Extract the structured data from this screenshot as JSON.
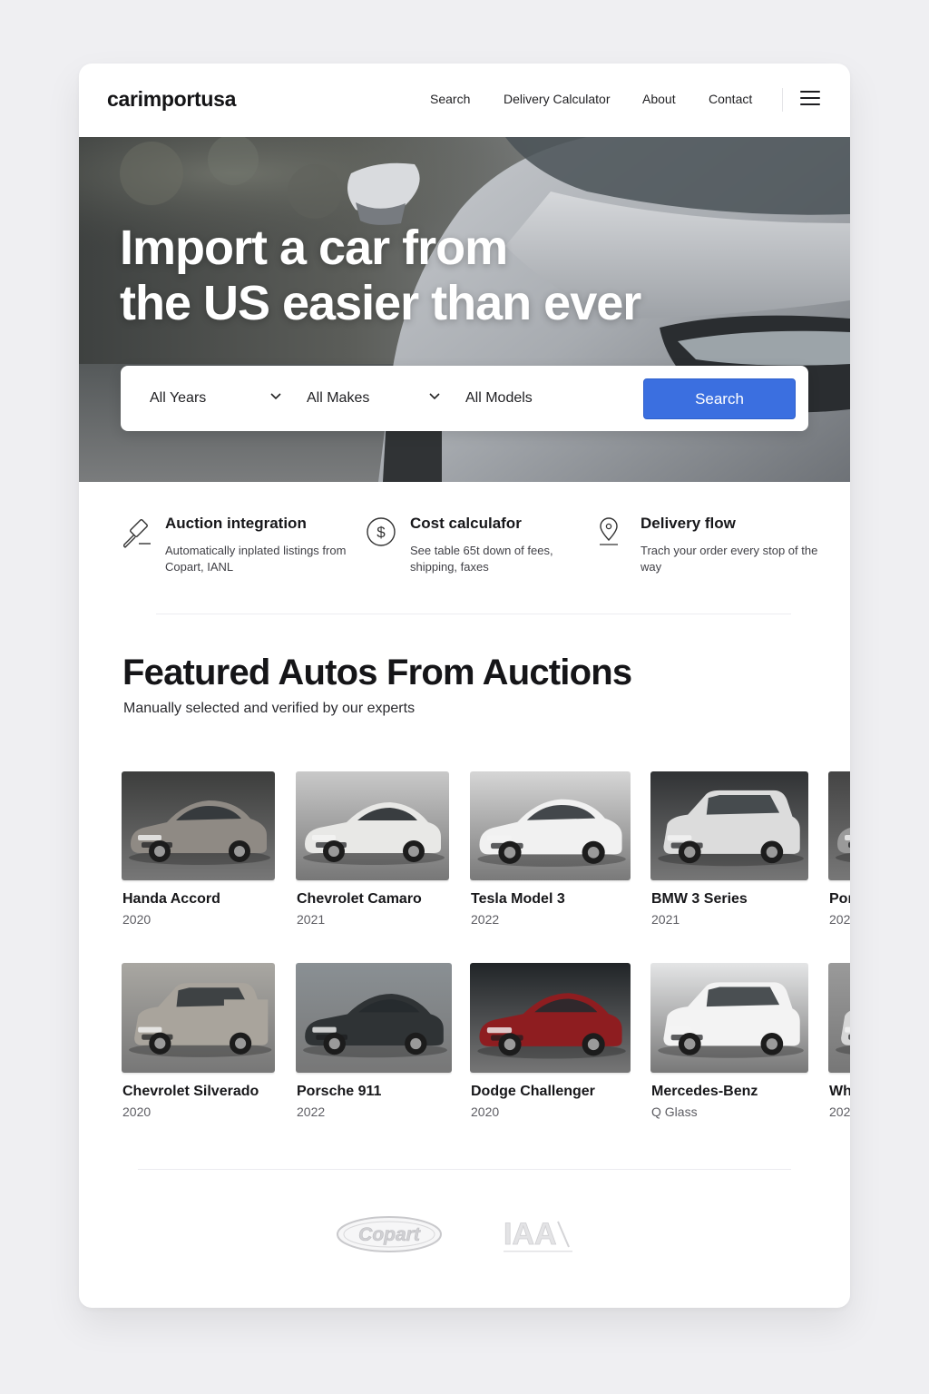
{
  "header": {
    "logo": "carimportusa",
    "nav": {
      "search": "Search",
      "delivery": "Delivery Calculator",
      "about": "About",
      "contact": "Contact"
    }
  },
  "hero": {
    "title_line1": "Import a car from",
    "title_line2": "the US easier than ever",
    "filters": {
      "years": "All Years",
      "makes": "All Makes",
      "models": "All Models"
    },
    "search_button": "Search"
  },
  "features": [
    {
      "title": "Auction integration",
      "desc": "Automatically inplated listings from Copart, IANL",
      "icon": "gavel-icon"
    },
    {
      "title": "Cost calculafor",
      "desc": "See table 65t down of fees, shipping, faxes",
      "icon": "dollar-icon"
    },
    {
      "title": "Delivery flow",
      "desc": "Trach your order every stop of the way",
      "icon": "location-pin-icon"
    }
  ],
  "featured": {
    "title": "Featured Autos From Auctions",
    "subtitle": "Manually selected and verified by our experts"
  },
  "cars": [
    {
      "name": "Handa Accord",
      "year": "2020",
      "color": "#8f8a84",
      "type": "sedan"
    },
    {
      "name": "Chevrolet Camaro",
      "year": "2021",
      "color": "#e8e8e6",
      "type": "coupe"
    },
    {
      "name": "Tesla Model 3",
      "year": "2022",
      "color": "#f1f1f1",
      "type": "sedan"
    },
    {
      "name": "BMW 3 Series",
      "year": "2021",
      "color": "#dcdcdc",
      "type": "suv"
    },
    {
      "name": "Por",
      "year": "202",
      "color": "#9a9a9a",
      "type": "sedan"
    },
    {
      "name": "Chevrolet Silverado",
      "year": "2020",
      "color": "#a9a49c",
      "type": "truck"
    },
    {
      "name": "Porsche 911",
      "year": "2022",
      "color": "#2f3335",
      "type": "coupe"
    },
    {
      "name": "Dodge Challenger",
      "year": "2020",
      "color": "#8e1d20",
      "type": "coupe"
    },
    {
      "name": "Mercedes-Benz",
      "year": "Q Glass",
      "color": "#f3f3f3",
      "type": "suv"
    },
    {
      "name": "Wh",
      "year": "202",
      "color": "#d7d7d7",
      "type": "suv"
    }
  ],
  "partners": {
    "copart": "Copart",
    "iaa": "IAA"
  },
  "colors": {
    "accent": "#3b6fe0",
    "text": "#17171a",
    "muted": "#5c5c62"
  }
}
